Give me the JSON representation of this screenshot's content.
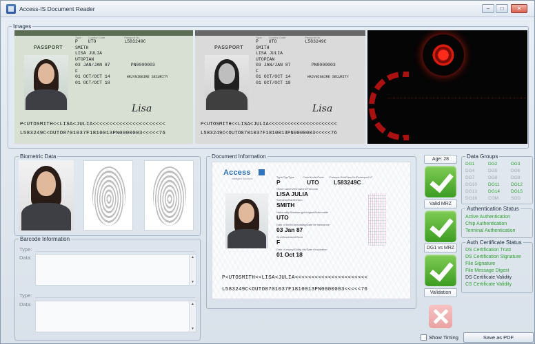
{
  "window": {
    "title": "Access-IS Document Reader"
  },
  "images": {
    "legend": "Images",
    "passport": {
      "word": "PASSPORT",
      "type_label": "Type",
      "type": "P",
      "country_label": "Country Code",
      "country": "UTO",
      "passport_no_label": "Passport No",
      "passport_no": "L583249C",
      "surname": "SMITH",
      "given_names": "LISA JULIA",
      "nationality": "UTOPIAN",
      "dob": "03 JAN/JAN 87",
      "personal_no": "PN0000003",
      "sex": "F",
      "doi": "01 OCT/OCT 14",
      "authority": "HRJVNIGGIRE SECURITY",
      "doe": "01 OCT/OCT 18",
      "signature": "Lisa",
      "mrz1": "P<UTOSMITH<<LISA<JULIA<<<<<<<<<<<<<<<<<<<<<<",
      "mrz2": "L583249C<OUTO8701037F1810013PN0000003<<<<<76"
    }
  },
  "biometric": {
    "legend": "Biometric Data"
  },
  "barcode": {
    "legend": "Barcode Information",
    "type_label_1": "Type:",
    "data_label_1": "Data:",
    "type_label_2": "Type:",
    "data_label_2": "Data:"
  },
  "document": {
    "legend": "Document Information",
    "brand": "Access",
    "brand_sub": "Intelligent Solutions",
    "col_type": "Type/Typ/Type",
    "val_type": "P",
    "col_code": "Code/Kode/Code",
    "val_code": "UTO",
    "col_passport": "Passport No/Pass-Nr/Passeport N°",
    "val_passport": "L583249C",
    "lab_given": "Given names/Vornamen/Prénoms",
    "val_given": "LISA JULIA",
    "lab_surname": "Surname/Name/Nom",
    "val_surname": "SMITH",
    "lab_nationality": "Nationality/Staatsangehörigkeit/Nationalité",
    "val_nationality": "UTO",
    "lab_dob": "Date of birth/Geburtstag/Date de naissance",
    "val_dob": "03 Jan 87",
    "lab_sex": "Sex/Geschlecht/Sexe",
    "val_sex": "F",
    "lab_doe": "Date of expiry/Gültig bis/Date d'expiration",
    "val_doe": "01 Oct 18",
    "mrz1": "P<UTOSMITH<<LISA<JULIA<<<<<<<<<<<<<<<<<<<<<<",
    "mrz2": "L583249C<OUTO8701037F1810013PN0000003<<<<<76"
  },
  "checks": {
    "age": "Age: 28",
    "valid_mrz": "Valid MRZ",
    "dg1_mrz": "DG1 vs MRZ",
    "validation": "Validation",
    "status": [
      "pass",
      "pass",
      "pass",
      "fail"
    ]
  },
  "data_groups": {
    "legend": "Data Groups",
    "items": [
      {
        "label": "DG1",
        "ok": true
      },
      {
        "label": "DG2",
        "ok": true
      },
      {
        "label": "DG3",
        "ok": true
      },
      {
        "label": "DG4",
        "ok": false
      },
      {
        "label": "DG5",
        "ok": false
      },
      {
        "label": "DG6",
        "ok": false
      },
      {
        "label": "DG7",
        "ok": false
      },
      {
        "label": "DG8",
        "ok": false
      },
      {
        "label": "DG9",
        "ok": false
      },
      {
        "label": "DG10",
        "ok": false
      },
      {
        "label": "DG11",
        "ok": true
      },
      {
        "label": "DG12",
        "ok": true
      },
      {
        "label": "DG13",
        "ok": false
      },
      {
        "label": "DG14",
        "ok": true
      },
      {
        "label": "DG15",
        "ok": true
      },
      {
        "label": "DG16",
        "ok": false
      },
      {
        "label": "COM",
        "ok": false
      },
      {
        "label": "SOD",
        "ok": false
      }
    ]
  },
  "auth_status": {
    "legend": "Authentication Status",
    "items": [
      "Active Authentication",
      "Chip Authentication",
      "Terminal Authentication"
    ]
  },
  "cert_status": {
    "legend": "Auth Certificate Status",
    "items": [
      "DS Certification Trust",
      "DS Certification Signature",
      "File Signature",
      "File Message Digest",
      "DS Certificate Validity",
      "CS Certificate Validity"
    ]
  },
  "footer": {
    "show_timing": "Show Timing",
    "save_pdf": "Save as PDF"
  },
  "colors": {
    "ok": "#2ea12e",
    "muted": "#a0a7ae",
    "uv_red": "#d61d10"
  }
}
